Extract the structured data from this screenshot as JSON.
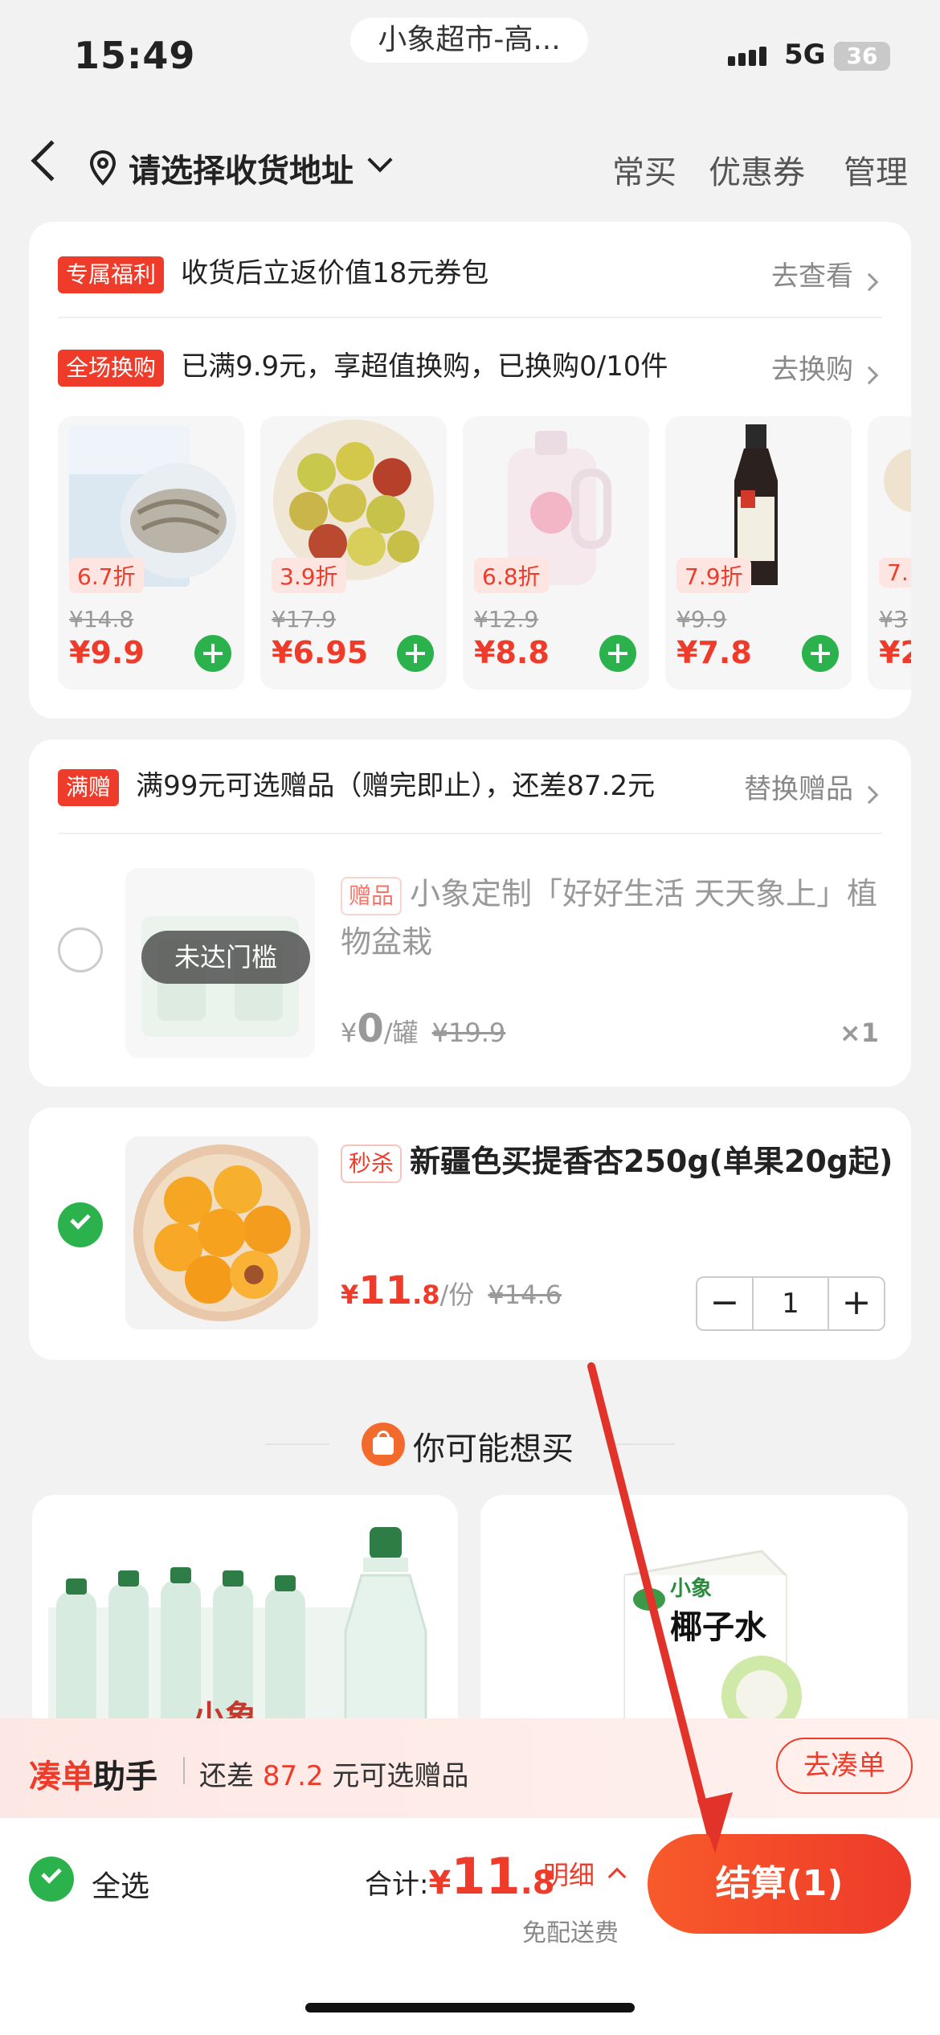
{
  "status": {
    "time": "15:49",
    "network": "5G",
    "battery": "36",
    "app_pill": "小象超市-高..."
  },
  "nav": {
    "address": "请选择收货地址",
    "links": [
      "常买",
      "优惠券",
      "管理"
    ]
  },
  "promo": {
    "row1": {
      "tag": "专属福利",
      "text": "收货后立返价值18元券包",
      "link": "去查看"
    },
    "row2": {
      "tag": "全场换购",
      "text": "已满9.9元，享超值换购，已换购0/10件",
      "link": "去换购"
    },
    "products": [
      {
        "discount": "6.7折",
        "old_price": "¥14.8",
        "price": "¥9.9",
        "img": "shrimp-image"
      },
      {
        "discount": "3.9折",
        "old_price": "¥17.9",
        "price": "¥6.95",
        "img": "jujube-image"
      },
      {
        "discount": "6.8折",
        "old_price": "¥12.9",
        "price": "¥8.8",
        "img": "detergent-image"
      },
      {
        "discount": "7.9折",
        "old_price": "¥9.9",
        "price": "¥7.8",
        "img": "soy-sauce-image"
      },
      {
        "discount": "7.",
        "old_price": "¥3",
        "price": "¥2",
        "img": "partial-product-image"
      }
    ]
  },
  "gift": {
    "tag": "满赠",
    "text": "满99元可选赠品（赠完即止），还差87.2元",
    "link": "替换赠品",
    "item_tag": "赠品",
    "title": "小象定制「好好生活 天天象上」植物盆栽",
    "overlay": "未达门槛",
    "price_symbol": "¥",
    "price": "0",
    "unit": "/罐",
    "old_price": "¥19.9",
    "qty": "×1"
  },
  "cart_item": {
    "tag": "秒杀",
    "title": "新疆色买提香杏250g(单果20g起)",
    "price_symbol": "¥",
    "price_int": "11",
    "price_dec": ".8",
    "unit": "/份",
    "old_price": "¥14.6",
    "quantity": "1",
    "minus": "−",
    "plus": "+"
  },
  "recommend": {
    "title": "你可能想买",
    "item1_label": "小象",
    "item2_label": "椰子水",
    "item2_brand": "小象"
  },
  "helper": {
    "brand1": "凑单",
    "brand2": "助手",
    "prefix": "还差",
    "amount": "87.2",
    "suffix": "元可选赠品",
    "button": "去凑单"
  },
  "footer": {
    "select_all": "全选",
    "total_label": "合计:",
    "symbol": "¥",
    "total_int": "11",
    "total_dec": ".8",
    "detail": "明细",
    "delivery": "免配送费",
    "checkout": "结算(1)"
  },
  "colors": {
    "accent": "#ee3b2a",
    "green": "#2bb24c"
  }
}
